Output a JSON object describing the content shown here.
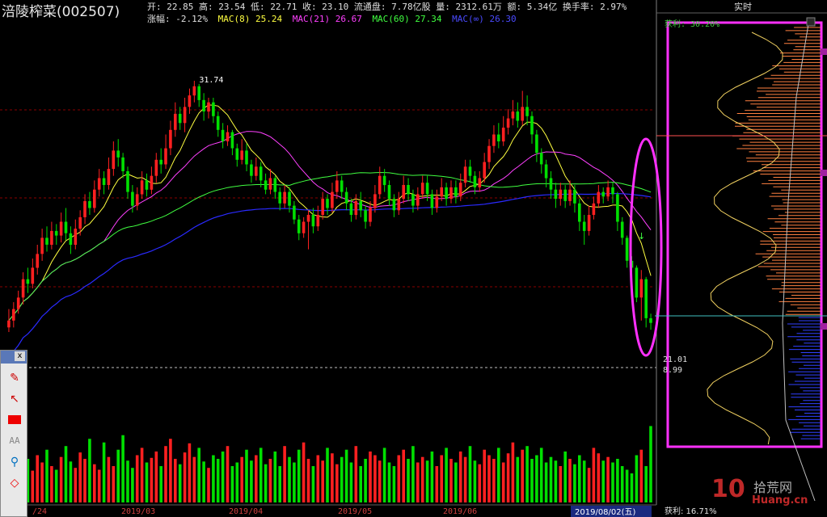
{
  "stock": {
    "name": "涪陵榨菜(002507)"
  },
  "quote_line": "开: 22.85 高: 23.54 低: 22.71 收: 23.10 流通盘: 7.78亿股 量: 2312.61万 额: 5.34亿 换手率: 2.97%",
  "ma_line": [
    {
      "text": "涨幅: -2.12%",
      "color": "#e0e0e0"
    },
    {
      "text": "MAC(8) 25.24",
      "color": "#ffff40"
    },
    {
      "text": "MAC(21) 26.67",
      "color": "#ff40ff"
    },
    {
      "text": "MAC(60) 27.34",
      "color": "#40ff40"
    },
    {
      "text": "MAC(∞) 26.30",
      "color": "#4040ff"
    }
  ],
  "colors": {
    "up": "#ff2020",
    "down": "#00e000",
    "ma8": "#ffff40",
    "ma21": "#ff40ff",
    "ma60": "#40ff40",
    "ma_inf": "#2a2aff",
    "grid": "#8a0000",
    "highlight": "#ff30ff",
    "chip_profit": "#ff8040",
    "chip_loss": "#3040ff"
  },
  "chart_data": {
    "type": "candlestick",
    "x_ticks": [
      "/24",
      "2019/03",
      "2019/04",
      "2019/05",
      "2019/06"
    ],
    "high_label": "31.74",
    "cursor_date": "2019/08/02(五)",
    "price_markers": [
      "21.01",
      "8.99"
    ],
    "ylim": [
      19.5,
      34.2
    ],
    "candles": [
      [
        21.0,
        21.3,
        20.8,
        21.8
      ],
      [
        21.3,
        21.8,
        21.0,
        22.1
      ],
      [
        21.8,
        22.3,
        21.6,
        22.6
      ],
      [
        22.3,
        23.1,
        22.0,
        23.4
      ],
      [
        23.1,
        22.9,
        22.5,
        23.6
      ],
      [
        22.9,
        23.6,
        22.7,
        24.0
      ],
      [
        23.6,
        24.2,
        23.3,
        24.6
      ],
      [
        24.2,
        24.9,
        23.9,
        25.3
      ],
      [
        24.9,
        24.6,
        24.3,
        25.4
      ],
      [
        24.6,
        25.2,
        24.4,
        25.6
      ],
      [
        25.2,
        25.0,
        24.6,
        25.5
      ],
      [
        25.0,
        25.6,
        24.7,
        26.0
      ],
      [
        25.6,
        25.1,
        24.8,
        26.2
      ],
      [
        25.1,
        24.6,
        24.2,
        25.4
      ],
      [
        24.6,
        25.3,
        24.4,
        25.7
      ],
      [
        25.3,
        25.8,
        25.0,
        26.1
      ],
      [
        25.8,
        26.5,
        25.5,
        26.8
      ],
      [
        26.5,
        26.2,
        25.9,
        26.9
      ],
      [
        26.2,
        27.0,
        26.0,
        27.4
      ],
      [
        27.0,
        27.5,
        26.7,
        27.9
      ],
      [
        27.5,
        27.2,
        26.8,
        27.8
      ],
      [
        27.2,
        27.9,
        27.0,
        28.4
      ],
      [
        27.9,
        28.7,
        27.6,
        29.1
      ],
      [
        28.7,
        28.4,
        28.0,
        29.2
      ],
      [
        28.4,
        27.8,
        27.5,
        28.6
      ],
      [
        27.8,
        26.9,
        26.6,
        28.0
      ],
      [
        26.9,
        26.3,
        26.0,
        27.2
      ],
      [
        26.3,
        26.8,
        26.1,
        27.1
      ],
      [
        26.8,
        27.4,
        26.6,
        27.8
      ],
      [
        27.4,
        27.0,
        26.7,
        27.7
      ],
      [
        27.0,
        27.6,
        26.8,
        28.0
      ],
      [
        27.6,
        28.3,
        27.3,
        28.6
      ],
      [
        28.3,
        28.1,
        27.7,
        28.8
      ],
      [
        28.1,
        28.8,
        27.9,
        29.4
      ],
      [
        28.8,
        29.6,
        28.5,
        30.0
      ],
      [
        29.6,
        30.3,
        29.3,
        30.8
      ],
      [
        30.3,
        29.9,
        29.6,
        30.6
      ],
      [
        29.9,
        30.6,
        29.5,
        31.0
      ],
      [
        30.6,
        31.1,
        30.3,
        31.4
      ],
      [
        31.1,
        31.5,
        30.8,
        31.74
      ],
      [
        31.5,
        30.9,
        30.6,
        31.6
      ],
      [
        30.9,
        30.4,
        30.0,
        31.2
      ],
      [
        30.4,
        30.8,
        30.1,
        31.0
      ],
      [
        30.8,
        30.2,
        29.9,
        31.0
      ],
      [
        30.2,
        29.6,
        29.3,
        30.4
      ],
      [
        29.6,
        29.1,
        28.8,
        29.9
      ],
      [
        29.1,
        29.5,
        28.9,
        29.8
      ],
      [
        29.5,
        28.8,
        28.5,
        29.6
      ],
      [
        28.8,
        28.3,
        28.0,
        29.0
      ],
      [
        28.3,
        28.7,
        28.1,
        29.2
      ],
      [
        28.7,
        28.1,
        27.8,
        29.0
      ],
      [
        28.1,
        27.6,
        27.3,
        28.3
      ],
      [
        27.6,
        28.0,
        27.4,
        28.4
      ],
      [
        28.0,
        27.4,
        27.1,
        28.2
      ],
      [
        27.4,
        27.0,
        26.8,
        27.7
      ],
      [
        27.0,
        27.5,
        26.8,
        27.9
      ],
      [
        27.5,
        26.9,
        26.6,
        27.6
      ],
      [
        26.9,
        26.4,
        26.1,
        27.1
      ],
      [
        26.4,
        26.9,
        26.2,
        27.2
      ],
      [
        26.9,
        26.3,
        26.0,
        27.1
      ],
      [
        26.3,
        25.7,
        25.5,
        26.5
      ],
      [
        25.7,
        25.1,
        24.8,
        25.9
      ],
      [
        25.1,
        25.6,
        24.9,
        25.8
      ],
      [
        25.6,
        25.9,
        24.4,
        26.1
      ],
      [
        25.9,
        25.4,
        25.1,
        26.2
      ],
      [
        25.4,
        25.9,
        25.2,
        26.3
      ],
      [
        25.9,
        26.6,
        25.7,
        26.9
      ],
      [
        26.6,
        26.2,
        25.9,
        26.8
      ],
      [
        26.2,
        26.9,
        26.0,
        27.3
      ],
      [
        26.9,
        27.4,
        26.6,
        27.8
      ],
      [
        27.4,
        26.9,
        26.6,
        27.6
      ],
      [
        26.9,
        26.4,
        26.1,
        27.1
      ],
      [
        26.4,
        25.9,
        25.6,
        26.6
      ],
      [
        25.9,
        26.5,
        25.7,
        26.8
      ],
      [
        26.5,
        26.1,
        25.8,
        26.9
      ],
      [
        26.1,
        25.6,
        25.3,
        26.3
      ],
      [
        25.6,
        26.2,
        25.4,
        26.5
      ],
      [
        26.2,
        26.8,
        26.0,
        27.2
      ],
      [
        26.8,
        27.6,
        26.6,
        28.0
      ],
      [
        27.6,
        27.2,
        26.9,
        27.9
      ],
      [
        27.2,
        26.6,
        26.3,
        27.4
      ],
      [
        26.6,
        26.1,
        25.8,
        26.8
      ],
      [
        26.1,
        26.6,
        25.9,
        26.9
      ],
      [
        26.6,
        27.2,
        26.4,
        27.6
      ],
      [
        27.2,
        26.8,
        26.5,
        27.5
      ],
      [
        26.8,
        26.3,
        26.0,
        27.0
      ],
      [
        26.3,
        26.8,
        26.1,
        27.1
      ],
      [
        26.8,
        27.3,
        26.6,
        27.6
      ],
      [
        27.3,
        26.8,
        26.5,
        27.6
      ],
      [
        26.8,
        26.2,
        25.9,
        27.0
      ],
      [
        26.2,
        26.7,
        26.0,
        27.0
      ],
      [
        26.7,
        27.1,
        26.5,
        27.5
      ],
      [
        27.1,
        26.6,
        26.3,
        27.3
      ],
      [
        26.6,
        27.1,
        26.4,
        27.4
      ],
      [
        27.1,
        26.7,
        26.4,
        27.4
      ],
      [
        26.7,
        27.3,
        26.5,
        27.7
      ],
      [
        27.3,
        28.0,
        27.1,
        28.3
      ],
      [
        28.0,
        27.6,
        27.3,
        28.3
      ],
      [
        27.6,
        27.1,
        26.8,
        27.8
      ],
      [
        27.1,
        27.5,
        26.9,
        27.8
      ],
      [
        27.5,
        28.2,
        27.3,
        28.6
      ],
      [
        28.2,
        28.9,
        27.9,
        29.2
      ],
      [
        28.9,
        29.4,
        28.6,
        29.8
      ],
      [
        29.4,
        29.1,
        28.8,
        29.9
      ],
      [
        29.1,
        29.7,
        28.9,
        30.2
      ],
      [
        29.7,
        30.1,
        29.4,
        30.5
      ],
      [
        30.1,
        30.4,
        29.8,
        30.9
      ],
      [
        30.4,
        30.0,
        29.7,
        30.8
      ],
      [
        30.0,
        30.6,
        29.8,
        31.3
      ],
      [
        30.6,
        30.2,
        29.8,
        31.1
      ],
      [
        30.2,
        29.4,
        29.0,
        30.4
      ],
      [
        29.4,
        28.6,
        28.2,
        29.6
      ],
      [
        28.6,
        28.1,
        27.7,
        28.8
      ],
      [
        28.1,
        27.5,
        27.1,
        28.3
      ],
      [
        27.5,
        27.0,
        26.6,
        27.8
      ],
      [
        27.0,
        26.6,
        26.2,
        27.3
      ],
      [
        26.6,
        27.0,
        26.3,
        27.3
      ],
      [
        27.0,
        26.5,
        26.2,
        27.2
      ],
      [
        26.5,
        27.0,
        26.3,
        27.4
      ],
      [
        27.0,
        26.4,
        26.0,
        27.2
      ],
      [
        26.4,
        25.6,
        25.2,
        26.6
      ],
      [
        25.6,
        25.2,
        24.6,
        25.9
      ],
      [
        25.2,
        25.9,
        25.0,
        26.3
      ],
      [
        25.9,
        26.4,
        25.7,
        26.7
      ],
      [
        26.4,
        26.9,
        26.2,
        27.2
      ],
      [
        26.9,
        26.7,
        26.4,
        27.1
      ],
      [
        26.7,
        27.1,
        26.5,
        27.4
      ],
      [
        27.1,
        26.8,
        26.4,
        27.3
      ],
      [
        26.8,
        25.6,
        25.2,
        26.9
      ],
      [
        25.6,
        24.9,
        24.6,
        25.8
      ],
      [
        24.9,
        23.9,
        23.6,
        25.0
      ],
      [
        23.9,
        23.6,
        23.2,
        24.1
      ],
      [
        23.6,
        22.3,
        22.1,
        23.7
      ],
      [
        22.3,
        23.1,
        21.3,
        23.5
      ],
      [
        23.1,
        21.4,
        21.0,
        23.2
      ],
      [
        21.4,
        21.2,
        20.9,
        21.6
      ]
    ],
    "volume": [
      42,
      55,
      38,
      60,
      48,
      35,
      52,
      44,
      58,
      40,
      36,
      50,
      62,
      45,
      38,
      55,
      48,
      70,
      42,
      36,
      66,
      50,
      40,
      58,
      74,
      46,
      38,
      52,
      60,
      44,
      49,
      56,
      40,
      62,
      70,
      48,
      42,
      55,
      65,
      50,
      60,
      45,
      38,
      52,
      48,
      56,
      62,
      40,
      44,
      50,
      58,
      46,
      52,
      60,
      42,
      48,
      56,
      40,
      62,
      50,
      44,
      58,
      66,
      48,
      40,
      52,
      46,
      60,
      54,
      42,
      50,
      58,
      44,
      62,
      40,
      48,
      56,
      52,
      46,
      60,
      44,
      40,
      52,
      58,
      48,
      62,
      44,
      50,
      46,
      56,
      40,
      52,
      60,
      48,
      44,
      56,
      50,
      62,
      46,
      42,
      58,
      52,
      48,
      60,
      44,
      54,
      66,
      50,
      58,
      62,
      48,
      52,
      60,
      44,
      50,
      46,
      40,
      56,
      48,
      42,
      52,
      46,
      38,
      60,
      54,
      46,
      50,
      44,
      48,
      40,
      36,
      32,
      52,
      58,
      40,
      84,
      80,
      104,
      130
    ],
    "vol_ylim": [
      0,
      135
    ],
    "chip_distribution": {
      "panel_title": "实时",
      "profit_label": "获利: 30.20%",
      "bottom_label": "获利: 16.71%",
      "price_range": [
        14.0,
        34.2
      ]
    }
  },
  "toolbar": {
    "close_label": "x",
    "icons": [
      "brush-icon",
      "arrow-icon",
      "rectangle-icon",
      "text-icon",
      "zoom-icon",
      "diamond-icon"
    ],
    "text_label": "AA"
  },
  "watermark": {
    "logo_text": "10",
    "cn_text": "拾荒网",
    "domain_text": "Huang.cn"
  }
}
